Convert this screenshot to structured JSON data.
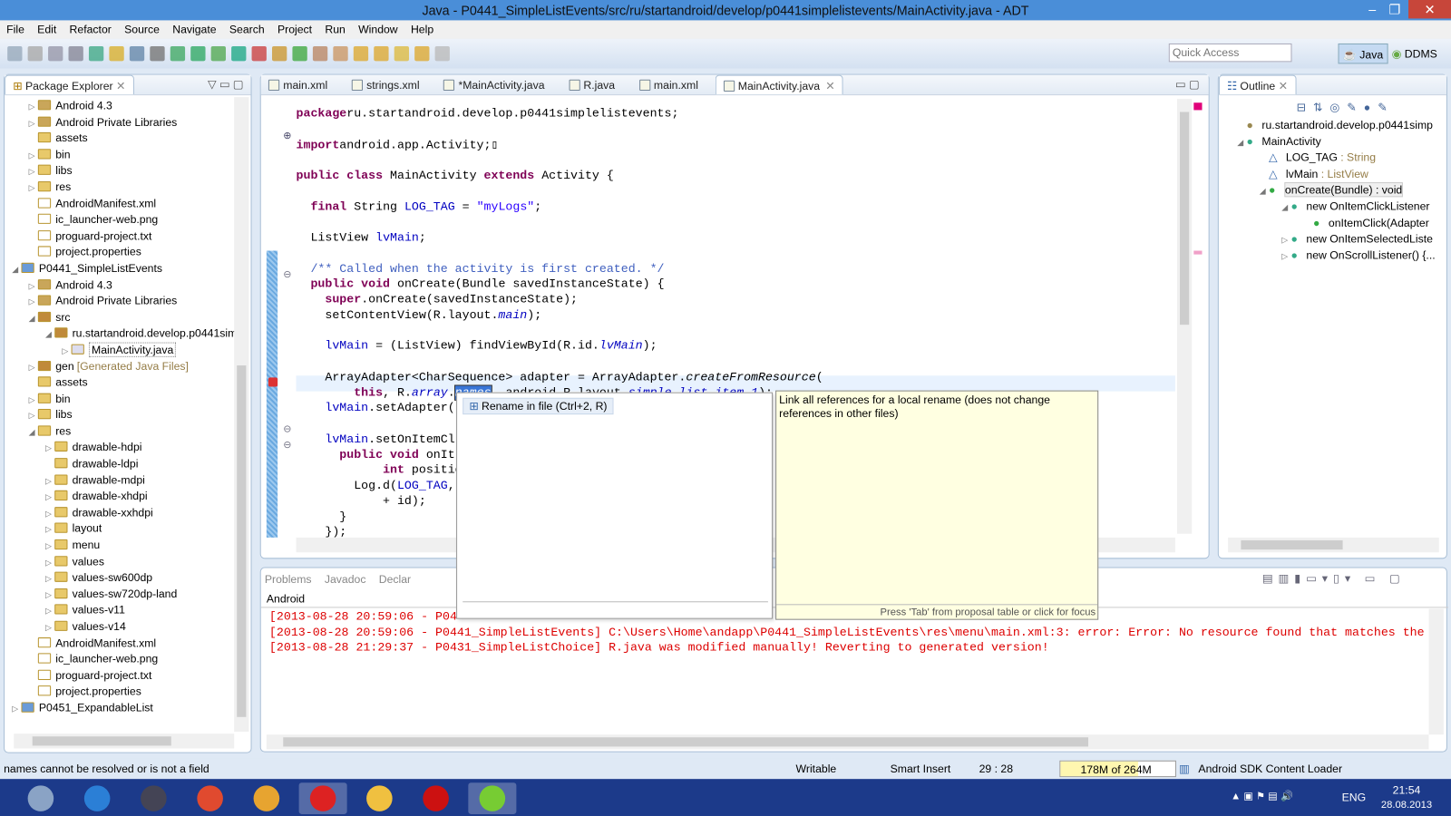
{
  "window": {
    "title": "Java - P0441_SimpleListEvents/src/ru/startandroid/develop/p0441simplelistevents/MainActivity.java - ADT",
    "minimize": "–",
    "restore": "❐",
    "close": "✕"
  },
  "menu": [
    "File",
    "Edit",
    "Refactor",
    "Source",
    "Navigate",
    "Search",
    "Project",
    "Run",
    "Window",
    "Help"
  ],
  "toolbar": {
    "quick_access_placeholder": "Quick Access",
    "perspectives": [
      "Java",
      "DDMS"
    ]
  },
  "package_explorer": {
    "title": "Package Explorer",
    "items": [
      {
        "label": "Android 4.3",
        "depth": 1,
        "tw": "▷",
        "icon": "library"
      },
      {
        "label": "Android Private Libraries",
        "depth": 1,
        "tw": "▷",
        "icon": "library"
      },
      {
        "label": "assets",
        "depth": 1,
        "tw": "",
        "icon": "folder"
      },
      {
        "label": "bin",
        "depth": 1,
        "tw": "▷",
        "icon": "folder"
      },
      {
        "label": "libs",
        "depth": 1,
        "tw": "▷",
        "icon": "folder"
      },
      {
        "label": "res",
        "depth": 1,
        "tw": "▷",
        "icon": "folder"
      },
      {
        "label": "AndroidManifest.xml",
        "depth": 1,
        "tw": "",
        "icon": "file"
      },
      {
        "label": "ic_launcher-web.png",
        "depth": 1,
        "tw": "",
        "icon": "file"
      },
      {
        "label": "proguard-project.txt",
        "depth": 1,
        "tw": "",
        "icon": "file"
      },
      {
        "label": "project.properties",
        "depth": 1,
        "tw": "",
        "icon": "file"
      },
      {
        "label": "P0441_SimpleListEvents",
        "depth": 0,
        "tw": "◢",
        "icon": "project"
      },
      {
        "label": "Android 4.3",
        "depth": 1,
        "tw": "▷",
        "icon": "library"
      },
      {
        "label": "Android Private Libraries",
        "depth": 1,
        "tw": "▷",
        "icon": "library"
      },
      {
        "label": "src",
        "depth": 1,
        "tw": "◢",
        "icon": "package"
      },
      {
        "label": "ru.startandroid.develop.p0441sim",
        "depth": 2,
        "tw": "◢",
        "icon": "package"
      },
      {
        "label": "MainActivity.java",
        "depth": 3,
        "tw": "▷",
        "icon": "java",
        "selected": true
      },
      {
        "label": "gen",
        "suffix": "[Generated Java Files]",
        "depth": 1,
        "tw": "▷",
        "icon": "package"
      },
      {
        "label": "assets",
        "depth": 1,
        "tw": "",
        "icon": "folder"
      },
      {
        "label": "bin",
        "depth": 1,
        "tw": "▷",
        "icon": "folder"
      },
      {
        "label": "libs",
        "depth": 1,
        "tw": "▷",
        "icon": "folder"
      },
      {
        "label": "res",
        "depth": 1,
        "tw": "◢",
        "icon": "folder"
      },
      {
        "label": "drawable-hdpi",
        "depth": 2,
        "tw": "▷",
        "icon": "folder"
      },
      {
        "label": "drawable-ldpi",
        "depth": 2,
        "tw": "",
        "icon": "folder"
      },
      {
        "label": "drawable-mdpi",
        "depth": 2,
        "tw": "▷",
        "icon": "folder"
      },
      {
        "label": "drawable-xhdpi",
        "depth": 2,
        "tw": "▷",
        "icon": "folder"
      },
      {
        "label": "drawable-xxhdpi",
        "depth": 2,
        "tw": "▷",
        "icon": "folder"
      },
      {
        "label": "layout",
        "depth": 2,
        "tw": "▷",
        "icon": "folder"
      },
      {
        "label": "menu",
        "depth": 2,
        "tw": "▷",
        "icon": "folder"
      },
      {
        "label": "values",
        "depth": 2,
        "tw": "▷",
        "icon": "folder"
      },
      {
        "label": "values-sw600dp",
        "depth": 2,
        "tw": "▷",
        "icon": "folder"
      },
      {
        "label": "values-sw720dp-land",
        "depth": 2,
        "tw": "▷",
        "icon": "folder"
      },
      {
        "label": "values-v11",
        "depth": 2,
        "tw": "▷",
        "icon": "folder"
      },
      {
        "label": "values-v14",
        "depth": 2,
        "tw": "▷",
        "icon": "folder"
      },
      {
        "label": "AndroidManifest.xml",
        "depth": 1,
        "tw": "",
        "icon": "file"
      },
      {
        "label": "ic_launcher-web.png",
        "depth": 1,
        "tw": "",
        "icon": "file"
      },
      {
        "label": "proguard-project.txt",
        "depth": 1,
        "tw": "",
        "icon": "file"
      },
      {
        "label": "project.properties",
        "depth": 1,
        "tw": "",
        "icon": "file"
      },
      {
        "label": "P0451_ExpandableList",
        "depth": 0,
        "tw": "▷",
        "icon": "project"
      }
    ]
  },
  "editor": {
    "tabs": [
      {
        "label": "main.xml"
      },
      {
        "label": "strings.xml"
      },
      {
        "label": "*MainActivity.java"
      },
      {
        "label": "R.java"
      },
      {
        "label": "main.xml"
      },
      {
        "label": "MainActivity.java",
        "active": true
      }
    ],
    "lines": [
      [
        0,
        [
          [
            "kw",
            "package"
          ],
          [
            "",
            "ru.startandroid.develop.p0441simplelistevents;"
          ]
        ]
      ],
      [
        2,
        [
          [
            "kw",
            "import"
          ],
          [
            "",
            "android.app.Activity;▯"
          ]
        ]
      ],
      [
        4,
        [
          [
            "kw",
            "public class"
          ],
          [
            "",
            " MainActivity "
          ],
          [
            "kw",
            "extends"
          ],
          [
            "",
            " Activity {"
          ]
        ]
      ],
      [
        6,
        [
          [
            "",
            "  "
          ],
          [
            "kw",
            "final"
          ],
          [
            "",
            " String "
          ],
          [
            "fd",
            "LOG_TAG"
          ],
          [
            "",
            " = "
          ],
          [
            "str",
            "\"myLogs\""
          ],
          [
            "",
            ";"
          ]
        ]
      ],
      [
        8,
        [
          [
            "",
            "  ListView "
          ],
          [
            "fd",
            "lvMain"
          ],
          [
            "",
            ";"
          ]
        ]
      ],
      [
        10,
        [
          [
            "cm",
            "  /** Called when the activity is first created. */"
          ]
        ]
      ],
      [
        11,
        [
          [
            "",
            "  "
          ],
          [
            "kw",
            "public void"
          ],
          [
            "",
            " onCreate(Bundle savedInstanceState) {"
          ]
        ]
      ],
      [
        12,
        [
          [
            "",
            "    "
          ],
          [
            "kw",
            "super"
          ],
          [
            "",
            ".onCreate(savedInstanceState);"
          ]
        ]
      ],
      [
        13,
        [
          [
            "",
            "    setContentView(R.layout."
          ],
          [
            "fdi",
            "main"
          ],
          [
            "",
            ");"
          ]
        ]
      ],
      [
        15,
        [
          [
            "",
            "    "
          ],
          [
            "fd",
            "lvMain"
          ],
          [
            "",
            " = (ListView) findViewById(R.id."
          ],
          [
            "fdi",
            "lvMain"
          ],
          [
            "",
            ");"
          ]
        ]
      ],
      [
        17,
        [
          [
            "",
            "    ArrayAdapter<CharSequence> adapter = ArrayAdapter."
          ],
          [
            "it",
            "createFromResource"
          ],
          [
            "",
            "("
          ]
        ]
      ],
      [
        18,
        [
          [
            "",
            "        "
          ],
          [
            "kw",
            "this"
          ],
          [
            "",
            ", R."
          ],
          [
            "fdi",
            "array"
          ],
          [
            "",
            "."
          ],
          [
            "sel",
            "names"
          ],
          [
            "",
            ", android.R.layout."
          ],
          [
            "fdi",
            "simple_list_item_1"
          ],
          [
            "",
            ");"
          ]
        ]
      ],
      [
        19,
        [
          [
            "",
            "    "
          ],
          [
            "fd",
            "lvMain"
          ],
          [
            "",
            ".setAdapter("
          ]
        ]
      ],
      [
        21,
        [
          [
            "",
            "    "
          ],
          [
            "fd",
            "lvMain"
          ],
          [
            "",
            ".setOnItemCl"
          ]
        ]
      ],
      [
        22,
        [
          [
            "",
            "      "
          ],
          [
            "kw",
            "public void"
          ],
          [
            "",
            " onIt"
          ]
        ]
      ],
      [
        23,
        [
          [
            "",
            "            "
          ],
          [
            "kw",
            "int"
          ],
          [
            "",
            " position"
          ]
        ]
      ],
      [
        24,
        [
          [
            "",
            "        Log.d("
          ],
          [
            "fd",
            "LOG_TAG"
          ],
          [
            "",
            ","
          ]
        ]
      ],
      [
        25,
        [
          [
            "",
            "            + id);"
          ]
        ]
      ],
      [
        26,
        [
          [
            "",
            "      }"
          ]
        ]
      ],
      [
        27,
        [
          [
            "",
            "    });"
          ]
        ]
      ]
    ]
  },
  "popup": {
    "proposal": "Rename in file (Ctrl+2, R)",
    "info": "Link all references for a local rename (does not change references in other files)",
    "footer": "Press 'Tab' from proposal table or click for focus"
  },
  "outline": {
    "title": "Outline",
    "items": [
      {
        "label": "ru.startandroid.develop.p0441simp",
        "depth": 0,
        "tw": ""
      },
      {
        "label": "MainActivity",
        "depth": 0,
        "tw": "◢"
      },
      {
        "label": "LOG_TAG",
        "type": " : String",
        "depth": 1,
        "tw": ""
      },
      {
        "label": "lvMain",
        "type": " : ListView",
        "depth": 1,
        "tw": ""
      },
      {
        "label": "onCreate(Bundle) : void",
        "depth": 1,
        "tw": "◢",
        "selected": true
      },
      {
        "label": "new OnItemClickListener",
        "depth": 2,
        "tw": "◢"
      },
      {
        "label": "onItemClick(Adapter",
        "depth": 3,
        "tw": ""
      },
      {
        "label": "new OnItemSelectedListe",
        "depth": 2,
        "tw": "▷"
      },
      {
        "label": "new OnScrollListener() {...",
        "depth": 2,
        "tw": "▷"
      }
    ]
  },
  "console": {
    "tabs": [
      "Problems",
      "Javadoc",
      "Declar"
    ],
    "title": "Android",
    "lines": [
      "[2013-08-28 20:59:06 - P04",
      "[2013-08-28 20:59:06 - P0441_SimpleListEvents] C:\\Users\\Home\\andapp\\P0441_SimpleListEvents\\res\\menu\\main.xml:3: error: Error: No resource found that matches the",
      "[2013-08-28 21:29:37 - P0431_SimpleListChoice] R.java was modified manually! Reverting to generated version!"
    ]
  },
  "status": {
    "message": "names cannot be resolved or is not a field",
    "writable": "Writable",
    "insert_mode": "Smart Insert",
    "position": "29 : 28",
    "heap": "178M of 264M",
    "heap_fraction": 0.674,
    "job": "Android SDK Content Loader"
  },
  "taskbar": {
    "apps": [
      "explorer",
      "internet-explorer",
      "media",
      "chrome",
      "app",
      "yandex",
      "folder",
      "acrobat",
      "adt"
    ],
    "lang": "ENG",
    "time": "21:54",
    "date": "28.08.2013"
  }
}
